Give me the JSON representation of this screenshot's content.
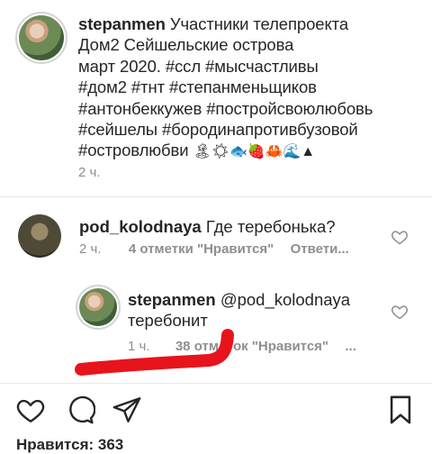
{
  "post": {
    "username": "stepanmen",
    "caption_lines": [
      "Участники телепроекта",
      "Дом2 Сейшельские острова",
      "март 2020. #ссл #мысчастливы",
      "#дом2 #тнт #степанменьщиков",
      "#антонбеккужев #постройсвоюлюбовь",
      "#сейшелы #бородинапротивбузовой",
      "#островлюбви"
    ],
    "caption_emoji": "🏝☀🐟🍓🦀🌊▲",
    "time": "2 ч."
  },
  "comment1": {
    "username": "pod_kolodnaya",
    "text": "Где теребонька?",
    "time": "2 ч.",
    "likes": "4 отметки \"Нравится\"",
    "reply": "Ответи..."
  },
  "reply1": {
    "username": "stepanmen",
    "mention": "@pod_kolodnaya",
    "text": "теребонит",
    "time": "1 ч.",
    "likes_visible_start": "38 отм",
    "likes_visible_end": "ок \"Нравится\"",
    "more": "..."
  },
  "actions": {
    "likes_label": "Нравится: 363"
  },
  "colors": {
    "annotation_red": "#e8141c",
    "meta_gray": "#8e8e8e"
  }
}
